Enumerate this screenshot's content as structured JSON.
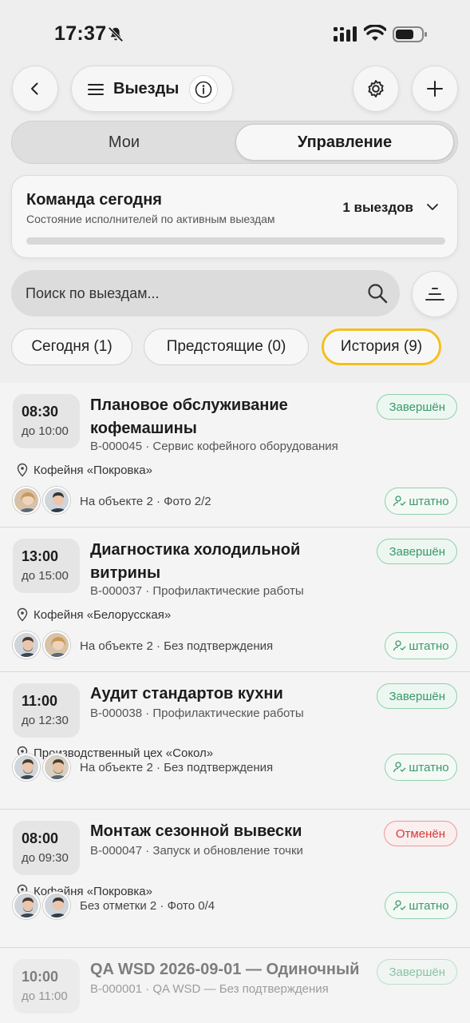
{
  "status": {
    "time": "17:37"
  },
  "header": {
    "title": "Выезды"
  },
  "tabs": {
    "mine": "Мои",
    "manage": "Управление"
  },
  "team": {
    "title": "Команда сегодня",
    "subtitle": "Состояние исполнителей по активным выездам",
    "count": "1 выездов"
  },
  "search": {
    "placeholder": "Поиск по выездам..."
  },
  "filters": {
    "today": "Сегодня (1)",
    "upcoming": "Предстоящие (0)",
    "history": "История (9)"
  },
  "visits": [
    {
      "start": "08:30",
      "end": "до 10:00",
      "title": "Плановое обслуживание кофемашины",
      "meta": "В-000045 · Сервис кофейного оборудования",
      "status": "Завершён",
      "location": "Кофейня «Покровка»",
      "presence": "На объекте 2 · Фото 2/2",
      "action": "штатно"
    },
    {
      "start": "13:00",
      "end": "до 15:00",
      "title": "Диагностика холодильной витрины",
      "meta": "В-000037 · Профилактические работы",
      "status": "Завершён",
      "location": "Кофейня «Белорусская»",
      "presence": "На объекте 2 · Без подтверждения",
      "action": "штатно"
    },
    {
      "start": "11:00",
      "end": "до 12:30",
      "title": "Аудит стандартов кухни",
      "meta": "В-000038 · Профилактические работы",
      "status": "Завершён",
      "location": "Производственный цех «Сокол»",
      "presence": "На объекте 2 · Без подтверждения",
      "action": "штатно"
    },
    {
      "start": "08:00",
      "end": "до 09:30",
      "title": "Монтаж сезонной вывески",
      "meta": "В-000047 · Запуск и обновление точки",
      "status": "Отменён",
      "location": "Кофейня «Покровка»",
      "presence": "Без отметки 2 · Фото 0/4",
      "action": "штатно"
    },
    {
      "start": "10:00",
      "end": "до 11:00",
      "title": "QA WSD 2026-09-01 — Одиночный",
      "meta": "В-000001 · QA WSD — Без подтверждения",
      "status": "Завершён"
    }
  ],
  "colors": {
    "accent_active_chip": "#f3c020",
    "done": "#3a9a6a",
    "cancelled": "#d23a3a"
  }
}
